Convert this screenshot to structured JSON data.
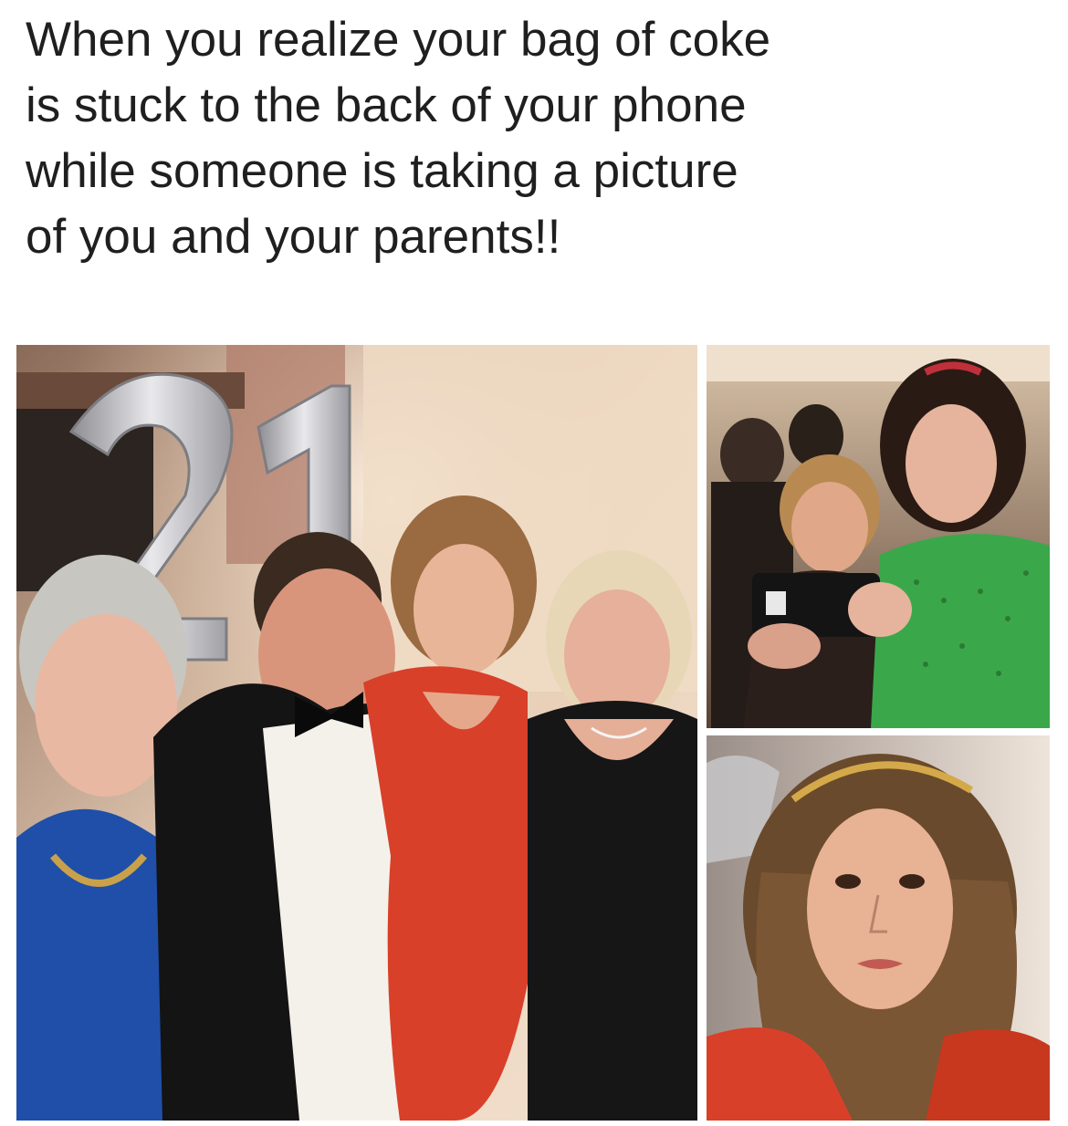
{
  "meme": {
    "caption_lines": [
      "When you realize your bag of coke",
      "is stuck to the back of your phone",
      "while someone is taking a picture",
      "of you and your parents!!"
    ],
    "balloon_numbers": "21"
  },
  "photos": {
    "group": {
      "icon": "family-group-photo"
    },
    "camera": {
      "icon": "person-taking-photo-with-phone"
    },
    "closeup": {
      "icon": "woman-closeup-surprised"
    }
  },
  "colors": {
    "background": "#ffffff",
    "caption_text": "#1f1f1f",
    "red_dress": "#d8402a",
    "green_dress": "#3aa84a",
    "blue_cardigan": "#1f4fa8",
    "balloon_silver": "#c9c9cc"
  }
}
